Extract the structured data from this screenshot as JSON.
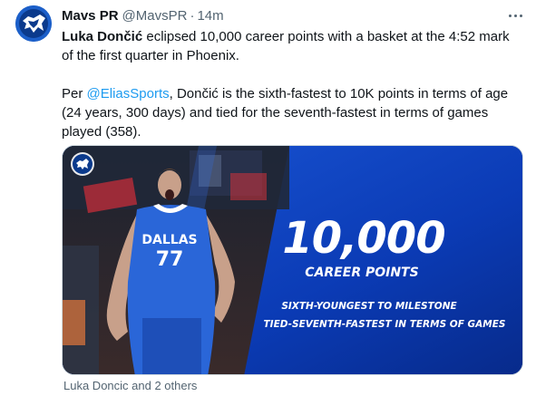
{
  "tweet": {
    "author_name": "Mavs PR",
    "handle": "@MavsPR",
    "separator": "·",
    "timestamp": "14m",
    "body": {
      "line1_bold": "Luka Dončić",
      "line1_rest": " eclipsed 10,000 career points with a basket at the 4:52 mark of the first quarter in Phoenix.",
      "p2_prefix": "Per ",
      "p2_mention": "@EliasSports",
      "p2_rest": ", Dončić is the sixth-fastest to 10K points in terms of age (24 years, 300 days) and tied for the seventh-fastest in terms of games played (358)."
    },
    "media": {
      "jersey_team": "DALLAS",
      "jersey_number": "77",
      "big_number": "10,000",
      "subtitle": "CAREER POINTS",
      "line1": "SIXTH-YOUNGEST TO MILESTONE",
      "line2": "TIED-SEVENTH-FASTEST IN TERMS OF GAMES"
    },
    "tagged": "Luka Doncic and 2 others"
  },
  "icons": [
    "mavs-logo-icon",
    "more-icon"
  ],
  "colors": {
    "mention": "#1d9bf0",
    "secondary_text": "#536471",
    "graphic_blue": "#0b3bb5",
    "jersey_blue": "#2a66d8"
  }
}
